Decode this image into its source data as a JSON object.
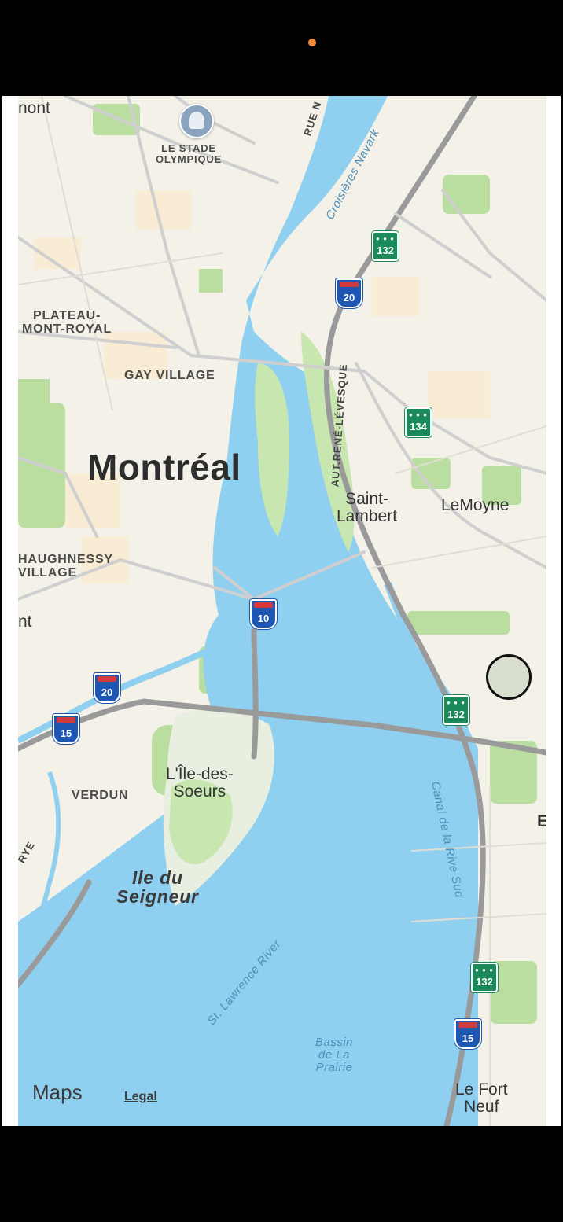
{
  "map": {
    "labels": {
      "city": "Montréal",
      "stade": "LE STADE\nOLYMPIQUE",
      "plateau": "PLATEAU-\nMONT-ROYAL",
      "gay_village": "GAY VILLAGE",
      "shaughnessy": "HAUGHNESSY\nVILLAGE",
      "verdun": "VERDUN",
      "saint_lambert": "Saint-\nLambert",
      "lemoyne": "LeMoyne",
      "ile_des_soeurs": "L'Île-des-\nSoeurs",
      "ile_du_seigneur": "Ile du\nSeigneur",
      "le_fort_neuf": "Le Fort\nNeuf",
      "mont_cut": "nont",
      "nt_cut": "nt",
      "e_cut": "E",
      "rye_cut": "RYE"
    },
    "roads": {
      "rue_notre_dame": "RUE N",
      "aut_rene_levesque": "AUT.RENÉ-LÉVESQUE",
      "croisieres": "Croisières Navark",
      "canal": "Canal de la Rive Sud",
      "st_lawrence": "St. Lawrence River",
      "bassin": "Bassin\nde La\nPrairie"
    },
    "shields": [
      {
        "type": "qc",
        "number": "132"
      },
      {
        "type": "aut",
        "number": "20"
      },
      {
        "type": "qc",
        "number": "134"
      },
      {
        "type": "aut",
        "number": "10"
      },
      {
        "type": "aut",
        "number": "20"
      },
      {
        "type": "aut",
        "number": "15"
      },
      {
        "type": "qc",
        "number": "132"
      },
      {
        "type": "qc",
        "number": "132"
      },
      {
        "type": "aut",
        "number": "15"
      }
    ]
  },
  "footer": {
    "apple_glyph": "",
    "brand": "Maps",
    "legal": "Legal"
  },
  "colors": {
    "water": "#8fd0f0",
    "land": "#f3f1e8",
    "park": "#b9dea0",
    "highway": "#9a9a9a",
    "accent_dot": "#f5883a"
  }
}
